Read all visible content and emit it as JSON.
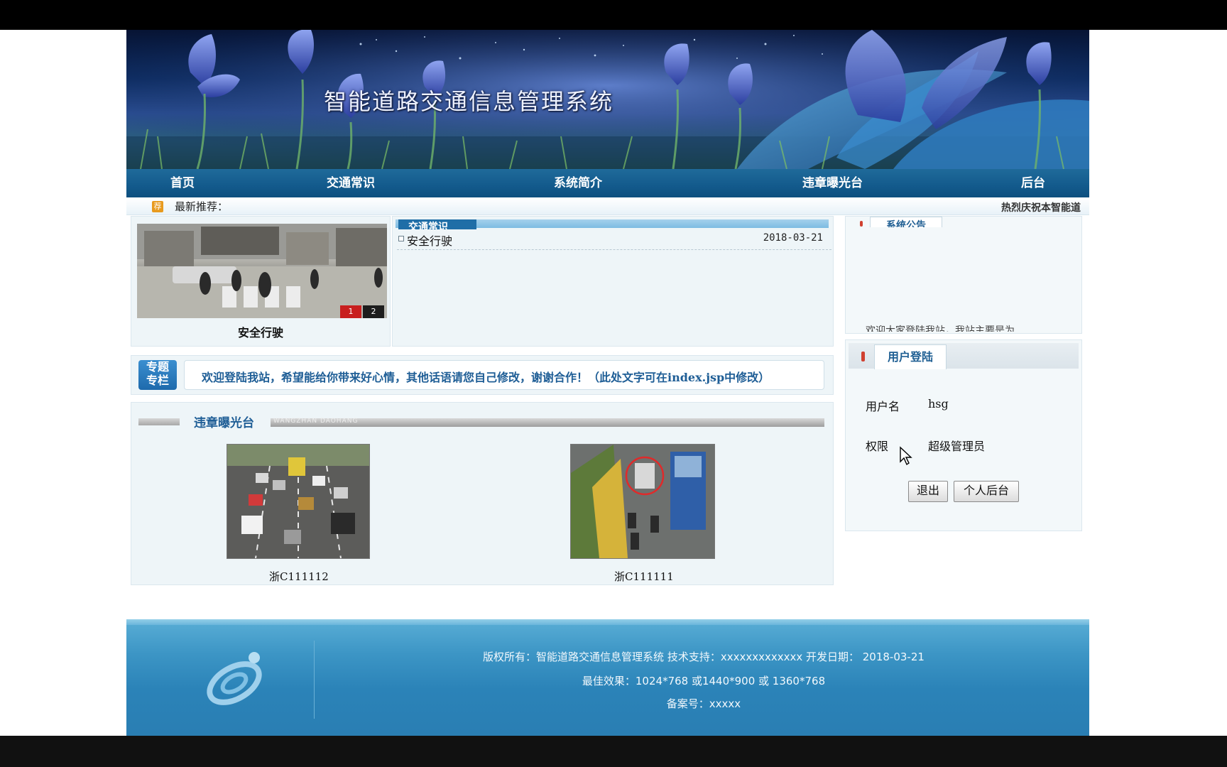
{
  "app": {
    "title": "智能道路交通信息管理系统"
  },
  "nav": {
    "items": [
      {
        "label": "首页"
      },
      {
        "label": "交通常识"
      },
      {
        "label": "系统简介"
      },
      {
        "label": "违章曝光台"
      },
      {
        "label": "后台"
      }
    ]
  },
  "recommend": {
    "label": "最新推荐：",
    "marquee": "热烈庆祝本智能道"
  },
  "feature": {
    "caption": "安全行驶",
    "slides": [
      "1",
      "2"
    ]
  },
  "news": {
    "tab": "交通常识",
    "items": [
      {
        "title": "安全行驶",
        "date": "2018-03-21"
      }
    ]
  },
  "notice": {
    "tab": "系统公告",
    "scroll_text": "欢迎大家登陆我站，我站主要是为"
  },
  "special": {
    "badge_line1": "专题",
    "badge_line2": "专栏",
    "text": "欢迎登陆我站，希望能给你带来好心情，其他话语请您自己修改，谢谢合作！（此处文字可在index.jsp中修改）"
  },
  "violations": {
    "title": "违章曝光台",
    "subtitle": "WANGZHAN DAOHANG",
    "items": [
      {
        "plate": "浙C111112"
      },
      {
        "plate": "浙C111111"
      }
    ]
  },
  "login": {
    "tab": "用户登陆",
    "username_label": "用户名",
    "username_value": "hsg",
    "role_label": "权限",
    "role_value": "超级管理员",
    "logout_button": "退出",
    "personal_button": "个人后台"
  },
  "footer": {
    "line1": "版权所有：智能道路交通信息管理系统 技术支持：xxxxxxxxxxxxx 开发日期： 2018-03-21",
    "line2": "最佳效果：1024*768 或1440*900 或 1360*768",
    "line3": "备案号：xxxxx"
  },
  "colors": {
    "nav_bg": "#135a8c",
    "accent_blue": "#1f5e96",
    "footer_bg": "#2b83b8"
  }
}
